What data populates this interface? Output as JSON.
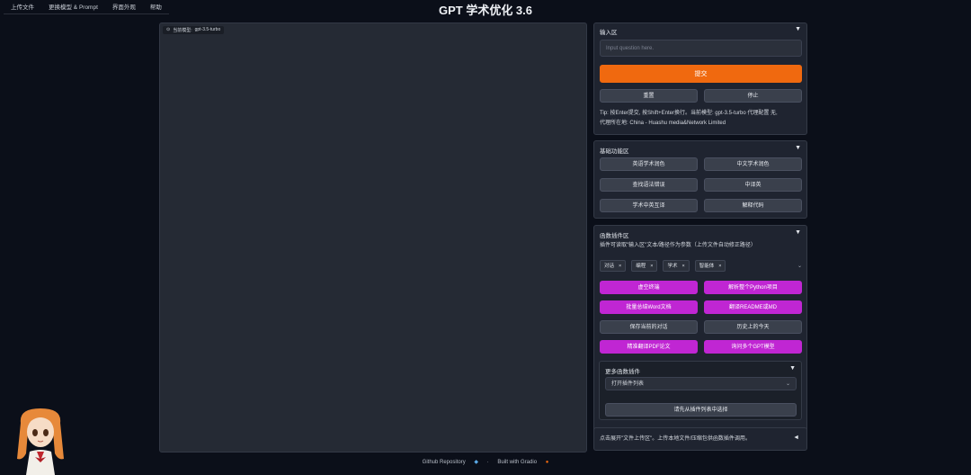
{
  "app": {
    "title": "GPT 学术优化 3.6"
  },
  "menu": [
    "上传文件",
    "更换模型 & Prompt",
    "界面外观",
    "帮助"
  ],
  "chat": {
    "model_label": "当前模型:",
    "model_value": "gpt-3.5-turbo"
  },
  "input_panel": {
    "title": "输入区",
    "placeholder": "Input question here.",
    "submit": "提交",
    "reset": "重置",
    "stop": "停止",
    "tip_line1": "Tip: 按Enter提交, 按Shift+Enter换行。当前模型: gpt-3.5-turbo 代理配置 无,",
    "tip_line2": "代理所在地:  China - Huashu media&Network Limited"
  },
  "basic_panel": {
    "title": "基础功能区",
    "buttons": [
      "英语学术润色",
      "中文学术润色",
      "查找语法错误",
      "中译英",
      "学术中英互译",
      "解释代码"
    ]
  },
  "plugin_panel": {
    "title": "函数插件区",
    "desc": "插件可读取\"输入区\"文本/路径作为参数（上传文件自动修正路径）",
    "tags": [
      "对话",
      "编程",
      "学术",
      "智能体"
    ],
    "buttons": [
      "虚空终端",
      "解析整个Python项目",
      "批量总结Word文档",
      "翻译README或MD",
      "保存当前的对话",
      "历史上的今天",
      "精准翻译PDF论文",
      "询问多个GPT模型"
    ],
    "more_title": "更多函数插件",
    "dropdown": "打开插件列表",
    "select_btn": "请先从插件列表中选择"
  },
  "upload_panel": {
    "text": "点击展开\"文件上传区\"。上传本地文件/压缩包供函数插件调用。"
  },
  "footer": {
    "github": "Github Repository",
    "gradio": "Built with Gradio"
  },
  "colors": {
    "accent_orange": "#f0690f",
    "plugin_magenta": "#c026d3",
    "background": "#0b0f19"
  }
}
